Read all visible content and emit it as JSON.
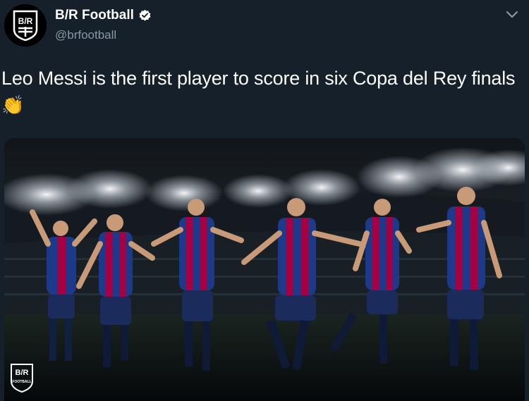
{
  "account": {
    "display_name": "B/R Football",
    "handle": "@brfootball",
    "avatar_text": "B/R",
    "verified": true
  },
  "tweet": {
    "text": "Leo Messi is the first player to score in six Copa del Rey finals",
    "emoji": "👏"
  },
  "media": {
    "watermark_text": "B/R",
    "watermark_sub": "FOOTBALL"
  },
  "colors": {
    "background": "#15202b",
    "secondary_text": "#8899a6",
    "verified_blue": "#1da1f2",
    "barca_red": "#a50044",
    "barca_blue": "#1d3a8a"
  }
}
